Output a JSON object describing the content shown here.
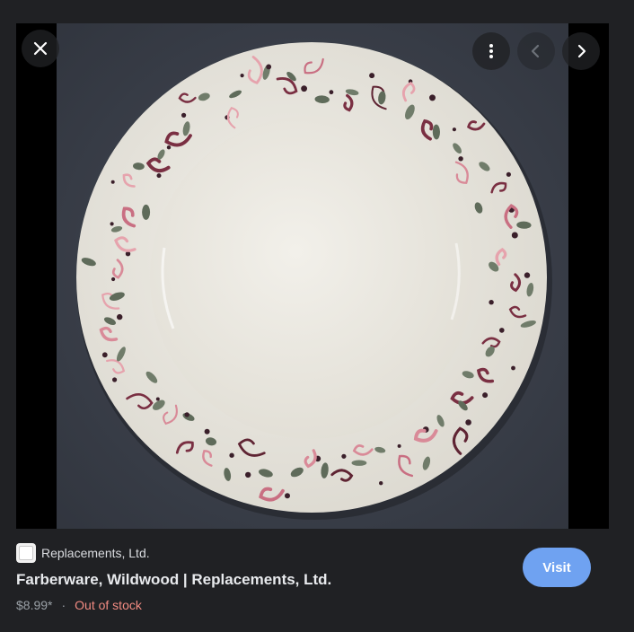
{
  "viewer": {
    "close_icon": "close-icon",
    "more_icon": "more-vert-icon",
    "prev_icon": "chevron-left-icon",
    "next_icon": "chevron-right-icon"
  },
  "image": {
    "alt": "Farberware, Wildwood | Replacements, Ltd."
  },
  "result": {
    "source": "Replacements, Ltd.",
    "title": "Farberware, Wildwood | Replacements, Ltd.",
    "price": "$8.99*",
    "separator": "·",
    "stock": "Out of stock",
    "visit_label": "Visit"
  },
  "colors": {
    "background": "#202124",
    "visit_button": "#8ab4f8",
    "stock_status": "#f28b82"
  }
}
